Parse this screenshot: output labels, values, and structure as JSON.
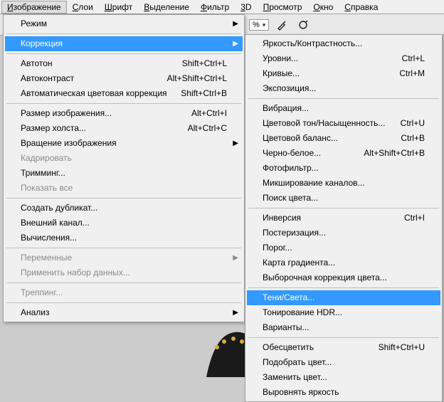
{
  "menubar": {
    "items": [
      {
        "label": "Изображение",
        "accel": "И",
        "active": true
      },
      {
        "label": "Слои",
        "accel": "С"
      },
      {
        "label": "Шрифт",
        "accel": "Ш"
      },
      {
        "label": "Выделение",
        "accel": "В"
      },
      {
        "label": "Фильтр",
        "accel": "Ф"
      },
      {
        "label": "3D",
        "accel": "3"
      },
      {
        "label": "Просмотр",
        "accel": "П"
      },
      {
        "label": "Окно",
        "accel": "О"
      },
      {
        "label": "Справка",
        "accel": "С"
      }
    ]
  },
  "toolbar": {
    "zoom_value": "%"
  },
  "image_menu": {
    "groups": [
      [
        {
          "label": "Режим",
          "submenu": true
        }
      ],
      [
        {
          "label": "Коррекция",
          "submenu": true,
          "highlight": true
        }
      ],
      [
        {
          "label": "Автотон",
          "shortcut": "Shift+Ctrl+L"
        },
        {
          "label": "Автоконтраст",
          "shortcut": "Alt+Shift+Ctrl+L"
        },
        {
          "label": "Автоматическая цветовая коррекция",
          "shortcut": "Shift+Ctrl+B"
        }
      ],
      [
        {
          "label": "Размер изображения...",
          "shortcut": "Alt+Ctrl+I"
        },
        {
          "label": "Размер холста...",
          "shortcut": "Alt+Ctrl+C"
        },
        {
          "label": "Вращение изображения",
          "submenu": true
        },
        {
          "label": "Кадрировать",
          "disabled": true
        },
        {
          "label": "Тримминг..."
        },
        {
          "label": "Показать все",
          "disabled": true
        }
      ],
      [
        {
          "label": "Создать дубликат..."
        },
        {
          "label": "Внешний канал..."
        },
        {
          "label": "Вычисления..."
        }
      ],
      [
        {
          "label": "Переменные",
          "submenu": true,
          "disabled": true
        },
        {
          "label": "Применить набор данных...",
          "disabled": true
        }
      ],
      [
        {
          "label": "Треппинг...",
          "disabled": true
        }
      ],
      [
        {
          "label": "Анализ",
          "submenu": true
        }
      ]
    ]
  },
  "correction_submenu": {
    "groups": [
      [
        {
          "label": "Яркость/Контрастность..."
        },
        {
          "label": "Уровни...",
          "shortcut": "Ctrl+L"
        },
        {
          "label": "Кривые...",
          "shortcut": "Ctrl+M"
        },
        {
          "label": "Экспозиция..."
        }
      ],
      [
        {
          "label": "Вибрация..."
        },
        {
          "label": "Цветовой тон/Насыщенность...",
          "shortcut": "Ctrl+U"
        },
        {
          "label": "Цветовой баланс...",
          "shortcut": "Ctrl+B"
        },
        {
          "label": "Черно-белое...",
          "shortcut": "Alt+Shift+Ctrl+B"
        },
        {
          "label": "Фотофильтр..."
        },
        {
          "label": "Микширование каналов..."
        },
        {
          "label": "Поиск цвета..."
        }
      ],
      [
        {
          "label": "Инверсия",
          "shortcut": "Ctrl+I"
        },
        {
          "label": "Постеризация..."
        },
        {
          "label": "Порог..."
        },
        {
          "label": "Карта градиента..."
        },
        {
          "label": "Выборочная коррекция цвета..."
        }
      ],
      [
        {
          "label": "Тени/Света...",
          "highlight": true
        },
        {
          "label": "Тонирование HDR..."
        },
        {
          "label": "Варианты..."
        }
      ],
      [
        {
          "label": "Обесцветить",
          "shortcut": "Shift+Ctrl+U"
        },
        {
          "label": "Подобрать цвет..."
        },
        {
          "label": "Заменить цвет..."
        },
        {
          "label": "Выровнять яркость"
        }
      ]
    ]
  }
}
